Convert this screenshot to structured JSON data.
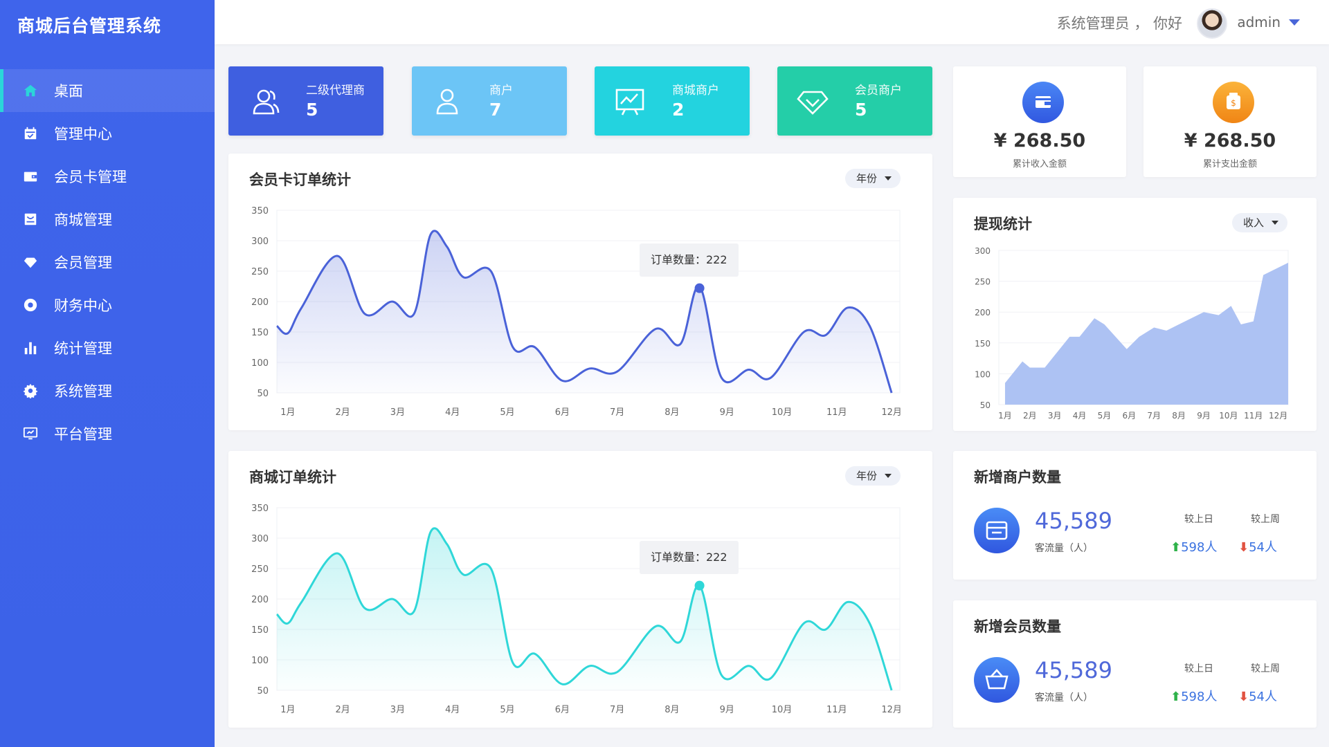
{
  "app_title": "商城后台管理系统",
  "sidebar": {
    "items": [
      {
        "label": "桌面",
        "icon": "home-icon",
        "active": true
      },
      {
        "label": "管理中心",
        "icon": "calendar-icon"
      },
      {
        "label": "会员卡管理",
        "icon": "wallet-icon"
      },
      {
        "label": "商城管理",
        "icon": "store-icon"
      },
      {
        "label": "会员管理",
        "icon": "diamond-icon"
      },
      {
        "label": "财务中心",
        "icon": "coin-icon"
      },
      {
        "label": "统计管理",
        "icon": "bar-chart-icon"
      },
      {
        "label": "系统管理",
        "icon": "gear-icon"
      },
      {
        "label": "平台管理",
        "icon": "monitor-icon"
      }
    ]
  },
  "header": {
    "greeting": "系统管理员 ， 你好",
    "username": "admin"
  },
  "stats": [
    {
      "label": "二级代理商",
      "value": "5",
      "icon": "users-icon",
      "color": "#3f5fe0"
    },
    {
      "label": "商户",
      "value": "7",
      "icon": "user-icon",
      "color": "#6cc5f6"
    },
    {
      "label": "商城商户",
      "value": "2",
      "icon": "trend-board-icon",
      "color": "#23d3df"
    },
    {
      "label": "会员商户",
      "value": "5",
      "icon": "diamond-icon",
      "color": "#24cea8"
    }
  ],
  "money": [
    {
      "value": "¥ 268.50",
      "label": "累计收入金额",
      "icon": "wallet-icon",
      "color": "#3f6df0"
    },
    {
      "value": "¥ 268.50",
      "label": "累计支出金额",
      "icon": "money-bag-icon",
      "color": "#f59a1b"
    }
  ],
  "member_chart": {
    "title": "会员卡订单统计",
    "filter": "年份",
    "tooltip": "订单数量：222"
  },
  "mall_chart": {
    "title": "商城订单统计",
    "filter": "年份",
    "tooltip": "订单数量：222"
  },
  "withdraw_chart": {
    "title": "提现统计",
    "filter": "收入"
  },
  "new_merchants": {
    "title": "新增商户数量",
    "value": "45,589",
    "sub": "客流量（人）",
    "col1_head": "较上日",
    "col2_head": "较上周",
    "col1_val": "598人",
    "col2_val": "54人"
  },
  "new_members": {
    "title": "新增会员数量",
    "value": "45,589",
    "sub": "客流量（人）",
    "col1_head": "较上日",
    "col2_head": "较上周",
    "col1_val": "598人",
    "col2_val": "54人"
  },
  "chart_data": [
    {
      "type": "line",
      "title": "会员卡订单统计",
      "x": [
        "1月",
        "2月",
        "3月",
        "4月",
        "5月",
        "6月",
        "7月",
        "8月",
        "9月",
        "10月",
        "11月",
        "12月"
      ],
      "y_ticks": [
        50,
        100,
        150,
        200,
        250,
        300,
        350
      ],
      "ylim": [
        50,
        350
      ],
      "series": [
        {
          "color": "#4a62d8",
          "points": [
            [
              0.8,
              160
            ],
            [
              1.0,
              148
            ],
            [
              1.25,
              190
            ],
            [
              1.9,
              275
            ],
            [
              2.4,
              180
            ],
            [
              2.9,
              200
            ],
            [
              3.3,
              180
            ],
            [
              3.6,
              310
            ],
            [
              3.9,
              290
            ],
            [
              4.2,
              240
            ],
            [
              4.7,
              250
            ],
            [
              5.1,
              125
            ],
            [
              5.5,
              125
            ],
            [
              6.0,
              70
            ],
            [
              6.5,
              90
            ],
            [
              7.0,
              85
            ],
            [
              7.7,
              155
            ],
            [
              8.15,
              130
            ],
            [
              8.5,
              225
            ],
            [
              8.9,
              75
            ],
            [
              9.4,
              88
            ],
            [
              9.8,
              75
            ],
            [
              10.4,
              150
            ],
            [
              10.8,
              145
            ],
            [
              11.2,
              190
            ],
            [
              11.6,
              160
            ],
            [
              12.0,
              50
            ]
          ]
        }
      ],
      "highlight": {
        "x": 8.5,
        "y": 222
      }
    },
    {
      "type": "line",
      "title": "商城订单统计",
      "x": [
        "1月",
        "2月",
        "3月",
        "4月",
        "5月",
        "6月",
        "7月",
        "8月",
        "9月",
        "10月",
        "11月",
        "12月"
      ],
      "y_ticks": [
        50,
        100,
        150,
        200,
        250,
        300,
        350
      ],
      "ylim": [
        50,
        350
      ],
      "series": [
        {
          "color": "#2fd7d8",
          "points": [
            [
              0.8,
              175
            ],
            [
              1.0,
              160
            ],
            [
              1.25,
              195
            ],
            [
              1.9,
              275
            ],
            [
              2.4,
              185
            ],
            [
              2.9,
              200
            ],
            [
              3.3,
              180
            ],
            [
              3.6,
              310
            ],
            [
              3.9,
              290
            ],
            [
              4.2,
              240
            ],
            [
              4.7,
              250
            ],
            [
              5.1,
              95
            ],
            [
              5.5,
              110
            ],
            [
              6.0,
              60
            ],
            [
              6.5,
              90
            ],
            [
              7.0,
              80
            ],
            [
              7.7,
              155
            ],
            [
              8.15,
              130
            ],
            [
              8.5,
              222
            ],
            [
              8.9,
              75
            ],
            [
              9.4,
              90
            ],
            [
              9.8,
              70
            ],
            [
              10.4,
              160
            ],
            [
              10.8,
              150
            ],
            [
              11.2,
              195
            ],
            [
              11.6,
              160
            ],
            [
              12.0,
              50
            ]
          ]
        }
      ],
      "highlight": {
        "x": 8.5,
        "y": 222
      }
    },
    {
      "type": "area",
      "title": "提现统计",
      "x": [
        "1月",
        "2月",
        "3月",
        "4月",
        "5月",
        "6月",
        "7月",
        "8月",
        "9月",
        "10月",
        "11月",
        "12月"
      ],
      "y_ticks": [
        50,
        100,
        150,
        200,
        250,
        300
      ],
      "ylim": [
        50,
        300
      ],
      "series": [
        {
          "color": "#a9bff2",
          "points": [
            [
              1,
              85
            ],
            [
              1.7,
              120
            ],
            [
              2,
              110
            ],
            [
              2.6,
              110
            ],
            [
              3.6,
              160
            ],
            [
              4,
              160
            ],
            [
              4.6,
              190
            ],
            [
              5,
              180
            ],
            [
              5.9,
              140
            ],
            [
              6.4,
              160
            ],
            [
              7,
              175
            ],
            [
              7.5,
              170
            ],
            [
              8,
              180
            ],
            [
              8.5,
              190
            ],
            [
              9,
              200
            ],
            [
              9.6,
              195
            ],
            [
              10.1,
              210
            ],
            [
              10.5,
              180
            ],
            [
              11,
              185
            ],
            [
              11.4,
              260
            ],
            [
              12.4,
              280
            ]
          ]
        }
      ]
    }
  ]
}
